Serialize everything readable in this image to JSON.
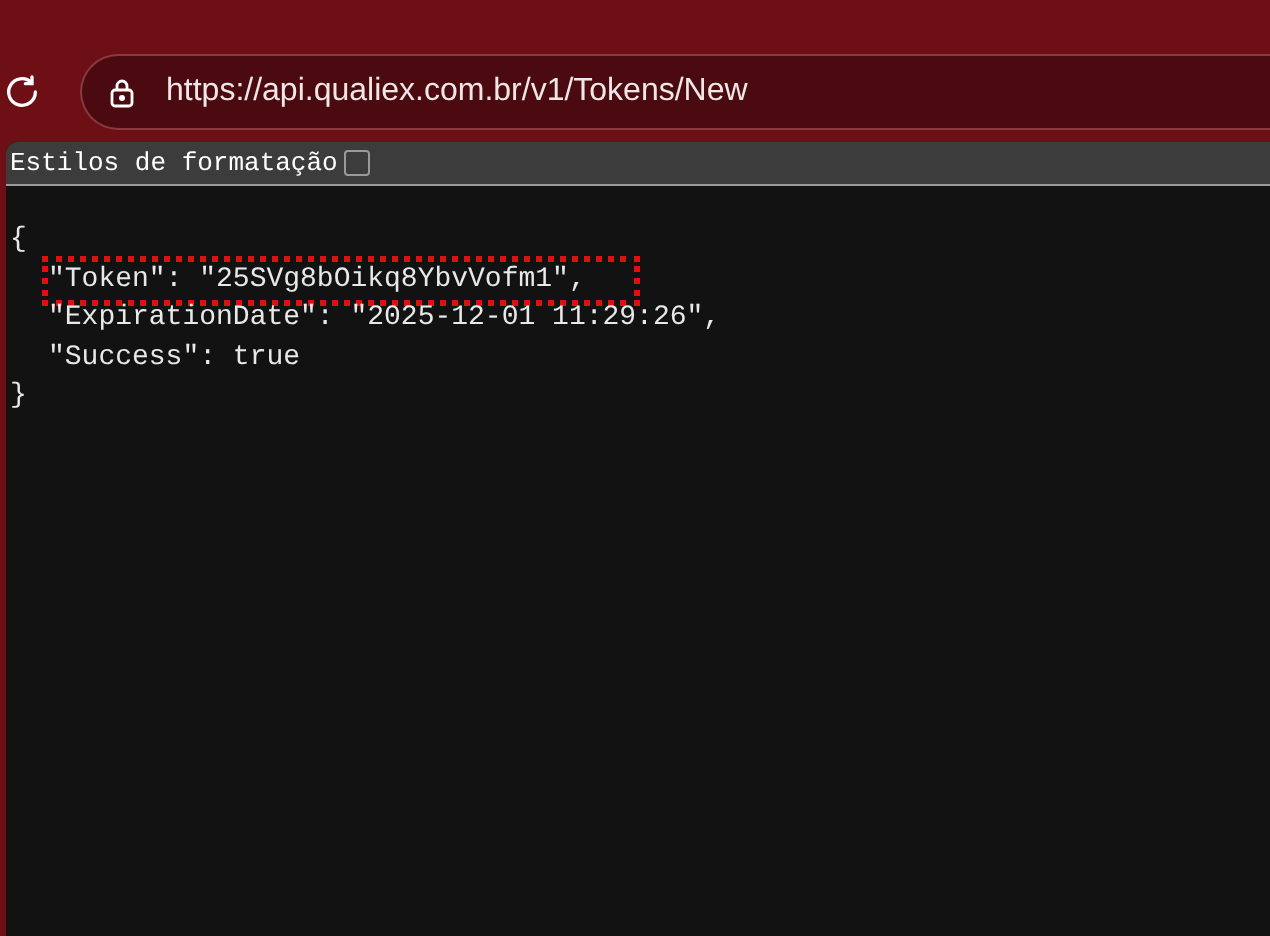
{
  "address_bar": {
    "url": "https://api.qualiex.com.br/v1/Tokens/New"
  },
  "toolbar": {
    "label": "Estilos de formatação",
    "checked": false
  },
  "json_lines": [
    {
      "kind": "brace",
      "text": "{",
      "highlighted": false
    },
    {
      "kind": "entry",
      "text": "\"Token\": \"25SVg8bOikq8YbvVofm1\",",
      "highlighted": true
    },
    {
      "kind": "entry",
      "text": "\"ExpirationDate\": \"2025-12-01 11:29:26\",",
      "highlighted": false
    },
    {
      "kind": "entry",
      "text": "\"Success\": true",
      "highlighted": false
    },
    {
      "kind": "brace",
      "text": "}",
      "highlighted": false
    }
  ]
}
